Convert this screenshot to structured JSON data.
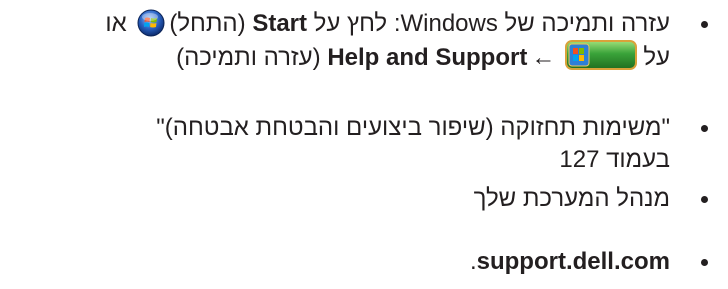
{
  "items": [
    {
      "line1": {
        "t1": "עזרה ותמיכה של ",
        "t2": "Windows",
        "t3": ": לחץ על ",
        "t4": "Start",
        "t5": " (התחל)",
        "t6": " או"
      },
      "line2": {
        "t1": "על",
        "arrow": "←",
        "t2": "Help and Support",
        "t3": " (עזרה ותמיכה)"
      }
    },
    {
      "line1": "\"משימות תחזוקה (שיפור ביצועים והבטחת אבטחה)\"",
      "line2": "בעמוד 127"
    },
    {
      "line1": "מנהל המערכת שלך"
    },
    {
      "link": "support.dell.com",
      "after": "."
    }
  ],
  "icons": {
    "orb": "windows-start-orb-icon",
    "start_button": "windows-start-button-icon"
  },
  "colors": {
    "text": "#231f20",
    "start_button_green": "#3aa33a",
    "orb_blue": "#2a63c4"
  }
}
